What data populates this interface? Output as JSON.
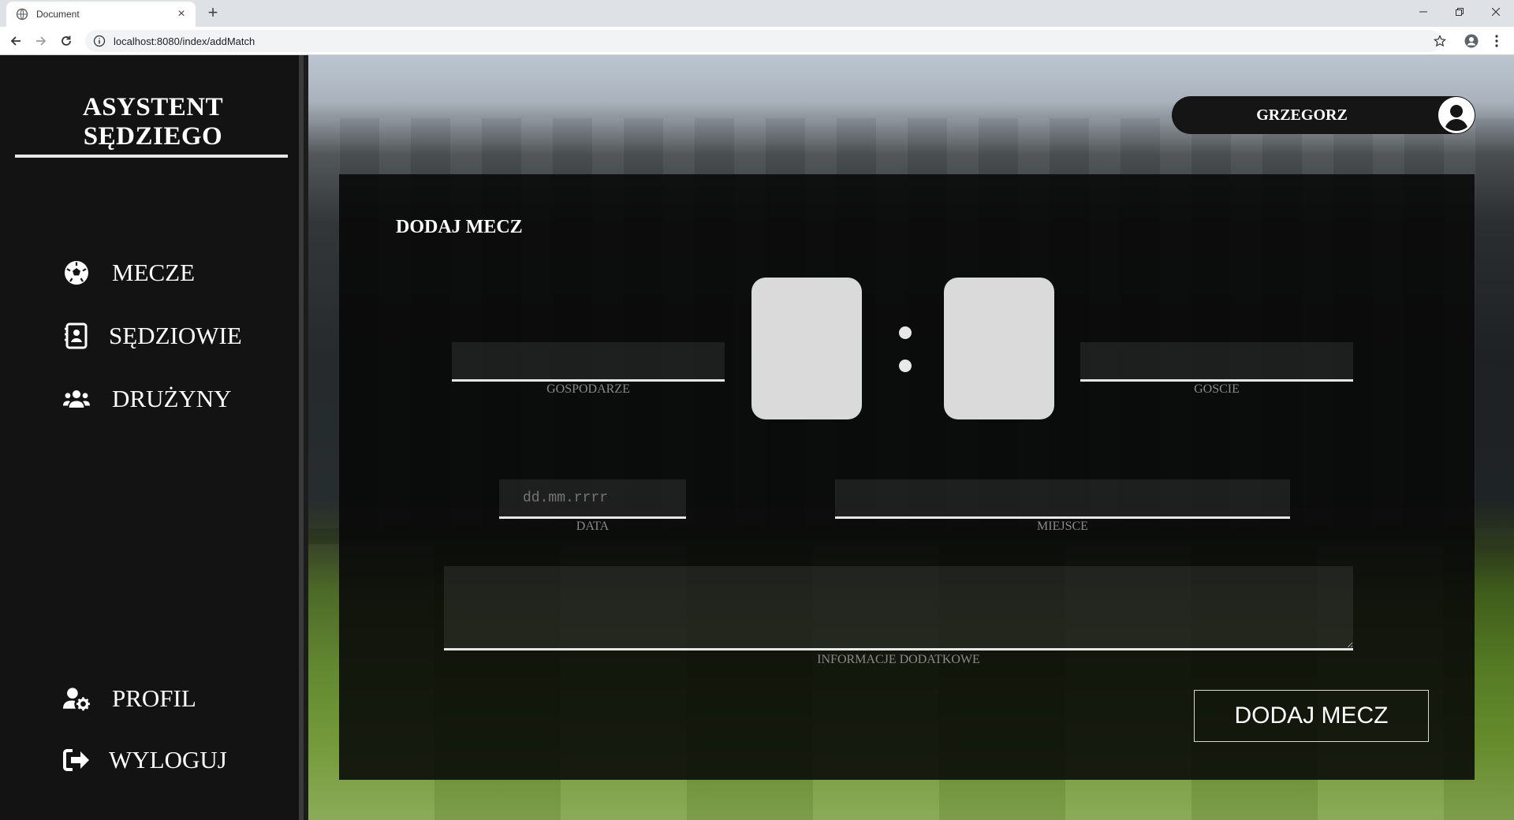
{
  "browser": {
    "tab_title": "Document",
    "new_tab": "+",
    "url": "localhost:8080/index/addMatch"
  },
  "sidebar": {
    "brand": "ASYSTENT SĘDZIEGO",
    "items": [
      {
        "label": "MECZE",
        "icon": "soccer-ball-icon"
      },
      {
        "label": "SĘDZIOWIE",
        "icon": "contact-card-icon"
      },
      {
        "label": "DRUŻYNY",
        "icon": "users-group-icon"
      },
      {
        "label": "PROFIL",
        "icon": "user-settings-icon"
      },
      {
        "label": "WYLOGUJ",
        "icon": "sign-out-icon"
      }
    ]
  },
  "user": {
    "name": "GRZEGORZ",
    "icon": "user-circle-icon"
  },
  "form": {
    "title": "DODAJ MECZ",
    "home": {
      "label": "GOSPODARZE",
      "value": ""
    },
    "away": {
      "label": "GOSCIE",
      "value": ""
    },
    "home_score": "",
    "away_score": "",
    "date": {
      "label": "DATA",
      "placeholder": "dd.mm.rrrr"
    },
    "place": {
      "label": "MIEJSCE",
      "value": ""
    },
    "info": {
      "label": "INFORMACJE DODATKOWE",
      "value": ""
    },
    "submit": "DODAJ MECZ"
  }
}
